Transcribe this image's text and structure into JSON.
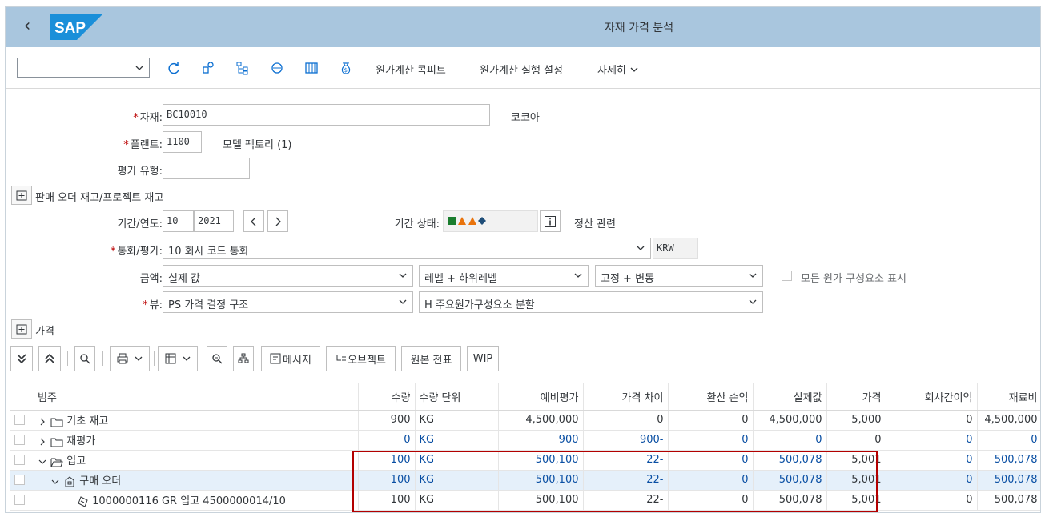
{
  "header": {
    "title": "자재 가격 분석",
    "logo_text": "SAP"
  },
  "toolbar": {
    "combo_value": "",
    "costing_cockpit": "원가계산 콕피트",
    "costing_run_settings": "원가계산 실행 설정",
    "more": "자세히"
  },
  "form": {
    "material_label": "자재:",
    "material_value": "BC10010",
    "material_desc": "코코아",
    "plant_label": "플랜트:",
    "plant_value": "1100",
    "plant_desc": "모델 팩토리 (1)",
    "valuation_type_label": "평가 유형:",
    "valuation_type_value": "",
    "sales_order_toggle": "판매 오더 재고/프로젝트 재고",
    "period_label": "기간/연도:",
    "period_value": "10",
    "year_value": "2021",
    "period_status_label": "기간 상태:",
    "settlement_label": "정산 관련",
    "currency_label": "통화/평가:",
    "currency_value": "10 회사 코드 통화",
    "currency_code": "KRW",
    "amount_label": "금액:",
    "amount_value": "실제 값",
    "level_value": "레벨 + 하위레벨",
    "fixed_value": "고정 + 변동",
    "show_all_components": "모든 원가 구성요소 표시",
    "view_label": "뷰:",
    "view_value": "PS 가격 결정 구조",
    "split_value": "H 주요원가구성요소 분할",
    "price_toggle": "가격"
  },
  "table_toolbar": {
    "message": "메시지",
    "object": "오브젝트",
    "original_doc": "원본 전표",
    "wip": "WIP"
  },
  "table": {
    "columns": [
      "범주",
      "수량",
      "수량 단위",
      "예비평가",
      "가격 차이",
      "환산 손익",
      "실제값",
      "가격",
      "회사간이익",
      "재료비"
    ],
    "rows": [
      {
        "category": "기초 재고",
        "qty": "900",
        "unit": "KG",
        "prelim": "4,500,000",
        "price_diff": "0",
        "exch_diff": "0",
        "actual": "4,500,000",
        "price": "5,000",
        "interco": "0",
        "material": "4,500,000"
      },
      {
        "category": "재평가",
        "qty": "0",
        "unit": "KG",
        "prelim": "900",
        "price_diff": "900-",
        "exch_diff": "0",
        "actual": "0",
        "price": "0",
        "interco": "0",
        "material": "0"
      },
      {
        "category": "입고",
        "qty": "100",
        "unit": "KG",
        "prelim": "500,100",
        "price_diff": "22-",
        "exch_diff": "0",
        "actual": "500,078",
        "price": "5,001",
        "interco": "0",
        "material": "500,078"
      },
      {
        "category": "구매 오더",
        "qty": "100",
        "unit": "KG",
        "prelim": "500,100",
        "price_diff": "22-",
        "exch_diff": "0",
        "actual": "500,078",
        "price": "5,001",
        "interco": "0",
        "material": "500,078"
      },
      {
        "category": "1000000116 GR 입고 4500000014/10",
        "qty": "100",
        "unit": "KG",
        "prelim": "500,100",
        "price_diff": "22-",
        "exch_diff": "0",
        "actual": "500,078",
        "price": "5,001",
        "interco": "0",
        "material": "500,078"
      }
    ]
  },
  "colors": {
    "shell": "#a9c6de",
    "accent": "#0a6ed1",
    "highlight": "#b30000"
  }
}
